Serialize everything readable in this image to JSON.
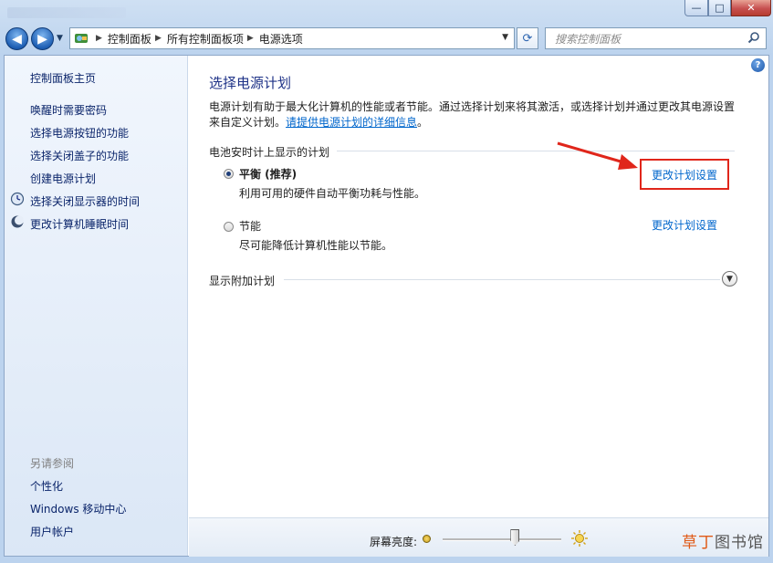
{
  "window": {
    "minimize_glyph": "—",
    "maximize_glyph": "□",
    "close_glyph": "✕"
  },
  "address_bar": {
    "breadcrumbs": [
      "控制面板",
      "所有控制面板项",
      "电源选项"
    ]
  },
  "search": {
    "placeholder": "搜索控制面板"
  },
  "sidebar": {
    "home": "控制面板主页",
    "items": [
      {
        "label": "唤醒时需要密码",
        "icon": ""
      },
      {
        "label": "选择电源按钮的功能",
        "icon": ""
      },
      {
        "label": "选择关闭盖子的功能",
        "icon": ""
      },
      {
        "label": "创建电源计划",
        "icon": ""
      },
      {
        "label": "选择关闭显示器的时间",
        "icon": "monitor-clock-icon"
      },
      {
        "label": "更改计算机睡眠时间",
        "icon": "moon-icon"
      }
    ],
    "see_also_heading": "另请参阅",
    "see_also": [
      "个性化",
      "Windows 移动中心",
      "用户帐户"
    ]
  },
  "main": {
    "title": "选择电源计划",
    "description_line": "电源计划有助于最大化计算机的性能或者节能。通过选择计划来将其激活，或选择计划并通过更改其电源设置来自定义计划。",
    "description_link": "请提供电源计划的详细信息",
    "description_end": "。",
    "section_heading": "电池安时计上显示的计划",
    "plans": [
      {
        "name": "平衡 (推荐)",
        "description": "利用可用的硬件自动平衡功耗与性能。",
        "selected": true,
        "change_link": "更改计划设置"
      },
      {
        "name": "节能",
        "description": "尽可能降低计算机性能以节能。",
        "selected": false,
        "change_link": "更改计划设置"
      }
    ],
    "extra_plans_heading": "显示附加计划"
  },
  "bottom": {
    "brightness_label": "屏幕亮度:",
    "brightness_level": 0.62
  },
  "watermark": {
    "accent": "草丁",
    "rest": "图书馆"
  },
  "colors": {
    "link": "#0066cc",
    "title": "#1e3287",
    "highlight": "#e0261b"
  }
}
